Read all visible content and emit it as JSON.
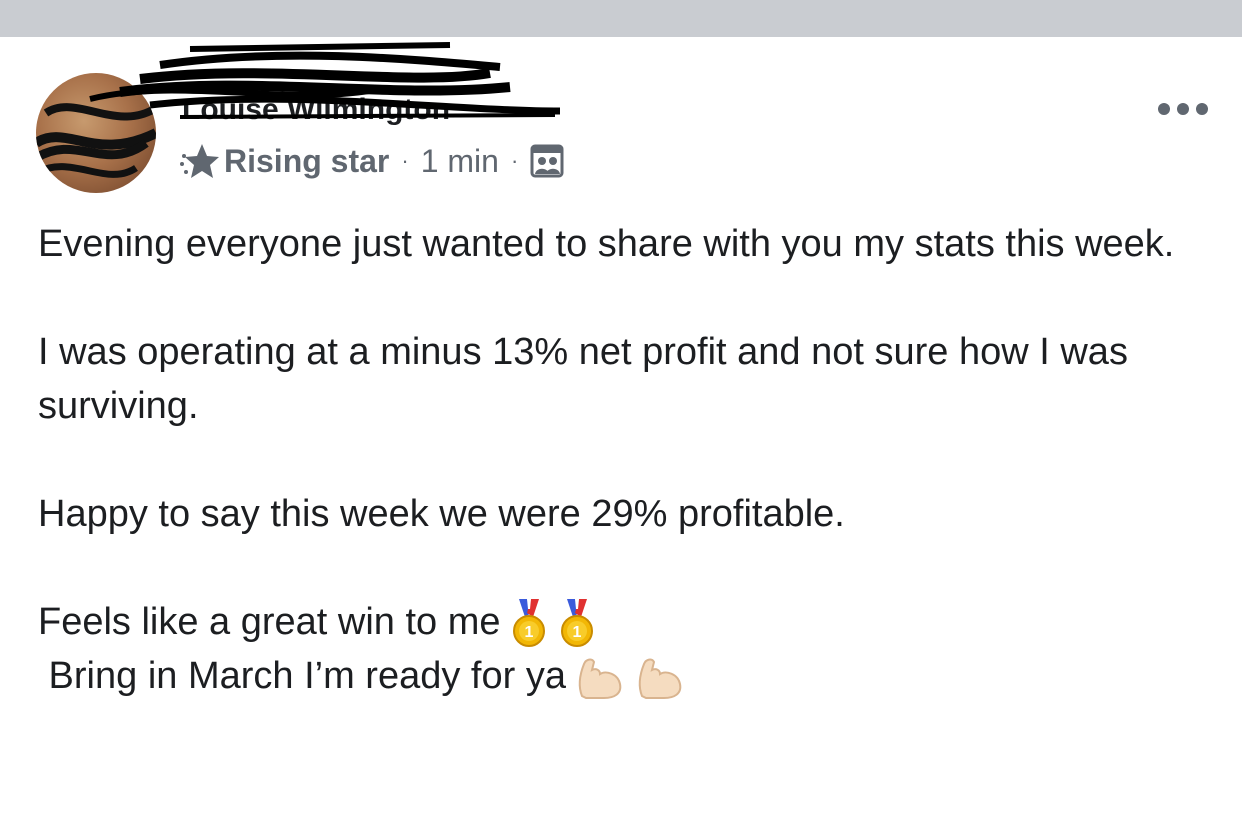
{
  "post": {
    "author_name": "Louise Wilmington",
    "badge": "Rising star",
    "time": "1 min",
    "separator": "·",
    "lines": {
      "line1": "Evening everyone just wanted to share with you my stats this week.",
      "line2": "I was operating at a minus 13% net profit and not sure how I was surviving.",
      "line3": "Happy to say this week we were 29% profitable.",
      "line4": "Feels like a great win to me",
      "line5": " Bring in March I’m ready for ya"
    }
  },
  "icons": {
    "badge_icon": "star-icon",
    "audience_icon": "group-audience-icon",
    "menu_icon": "more-options-icon",
    "emoji_medal": "first-place-medal-icon",
    "emoji_flex": "flexed-biceps-icon"
  },
  "colors": {
    "top_bar": "#c9ccd1",
    "text": "#1c1e21",
    "meta_text": "#606770"
  }
}
